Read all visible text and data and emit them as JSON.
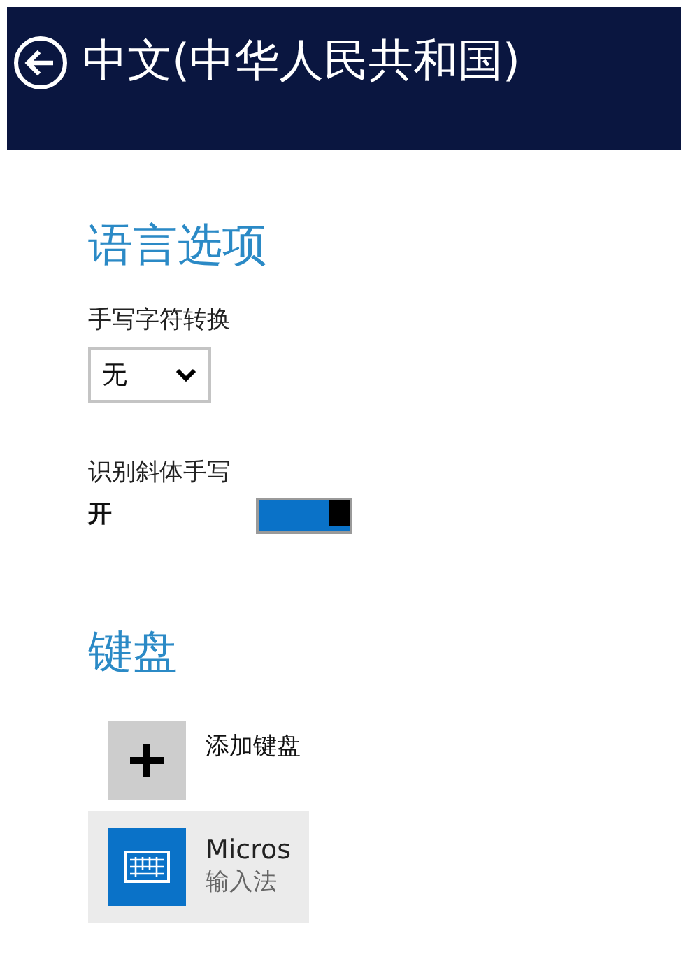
{
  "header": {
    "title": "中文(中华人民共和国)"
  },
  "sections": [
    {
      "heading": "语言选项",
      "settings": [
        {
          "kind": "dropdown",
          "label": "手写字符转换",
          "value": "无"
        },
        {
          "kind": "toggle",
          "label": "识别斜体手写",
          "state_text": "开",
          "on": true
        }
      ]
    },
    {
      "heading": "键盘",
      "items": [
        {
          "kind": "add",
          "label": "添加键盘"
        },
        {
          "kind": "keyboard",
          "name": "Micros",
          "subtitle": "输入法"
        }
      ]
    }
  ]
}
